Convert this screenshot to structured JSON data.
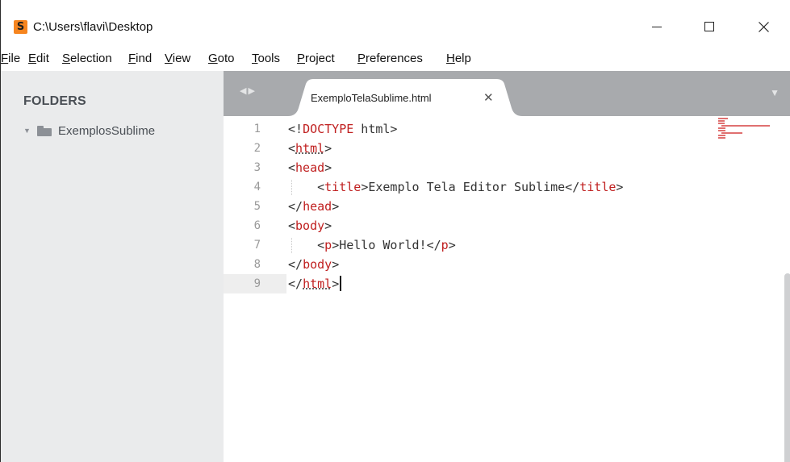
{
  "window": {
    "title": "C:\\Users\\flavi\\Desktop",
    "app_icon_letter": "S"
  },
  "menu": [
    "File",
    "Edit",
    "Selection",
    "Find",
    "View",
    "Goto",
    "Tools",
    "Project",
    "Preferences",
    "Help"
  ],
  "sidebar": {
    "header": "FOLDERS",
    "folders": [
      {
        "name": "ExemplosSublime",
        "expanded": true
      }
    ]
  },
  "tabs": [
    {
      "label": "ExemploTelaSublime.html",
      "active": true
    }
  ],
  "editor": {
    "current_line": 9,
    "lines": [
      {
        "num": "1",
        "text": "<!DOCTYPE html>"
      },
      {
        "num": "2",
        "text": "<html>"
      },
      {
        "num": "3",
        "text": "<head>"
      },
      {
        "num": "4",
        "text": "    <title>Exemplo Tela Editor Sublime</title>"
      },
      {
        "num": "5",
        "text": "</head>"
      },
      {
        "num": "6",
        "text": "<body>"
      },
      {
        "num": "7",
        "text": "    <p>Hello World!</p>"
      },
      {
        "num": "8",
        "text": "</body>"
      },
      {
        "num": "9",
        "text": "</html>"
      }
    ]
  },
  "colors": {
    "sidebar_bg": "#eaebec",
    "tabbar_bg": "#a8aaad",
    "tag_red": "#c02020",
    "accent_orange": "#f6851f"
  }
}
